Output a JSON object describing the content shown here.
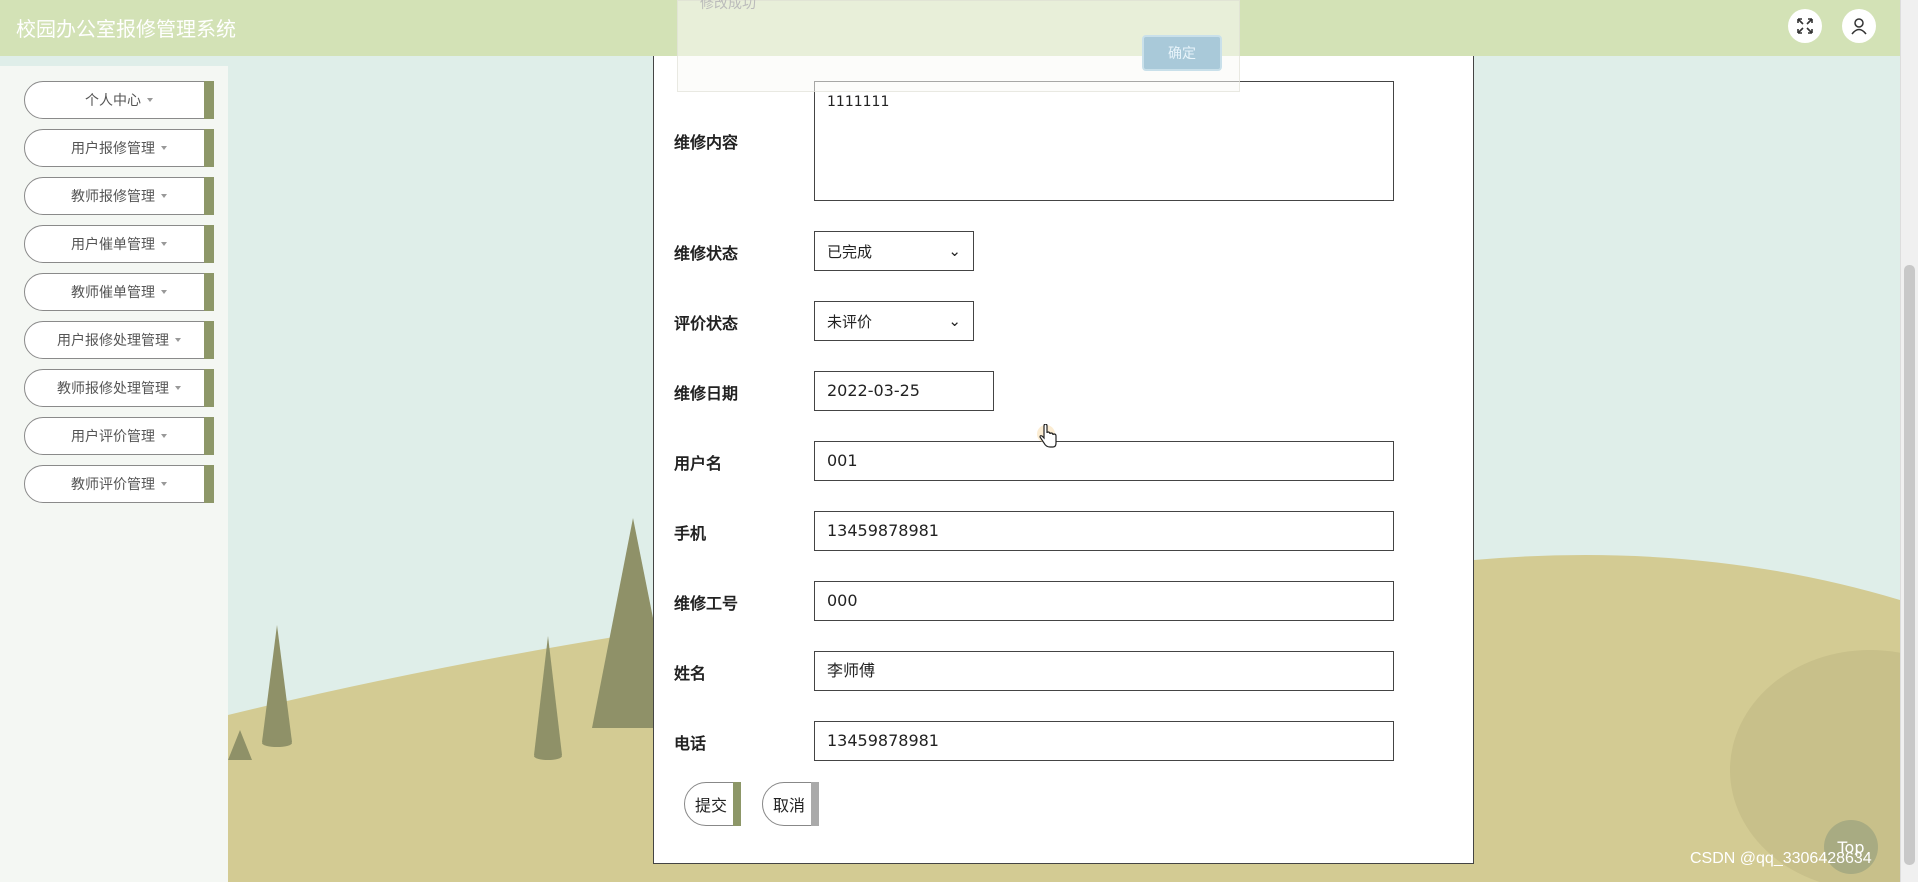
{
  "app": {
    "title": "校园办公室报修管理系统"
  },
  "header": {
    "icons": [
      "fullscreen-icon",
      "user-icon"
    ]
  },
  "sidebar": {
    "items": [
      {
        "label": "个人中心"
      },
      {
        "label": "用户报修管理"
      },
      {
        "label": "教师报修管理"
      },
      {
        "label": "用户催单管理"
      },
      {
        "label": "教师催单管理"
      },
      {
        "label": "用户报修处理管理"
      },
      {
        "label": "教师报修处理管理"
      },
      {
        "label": "用户评价管理"
      },
      {
        "label": "教师评价管理"
      }
    ]
  },
  "toast": {
    "message": "修改成功",
    "ok_label": "确定"
  },
  "form": {
    "content": {
      "label": "维修内容",
      "value": "1111111"
    },
    "status": {
      "label": "维修状态",
      "value": "已完成"
    },
    "review": {
      "label": "评价状态",
      "value": "未评价"
    },
    "date": {
      "label": "维修日期",
      "value": "2022-03-25"
    },
    "username": {
      "label": "用户名",
      "value": "001"
    },
    "phone": {
      "label": "手机",
      "value": "13459878981"
    },
    "worker_id": {
      "label": "维修工号",
      "value": "000"
    },
    "name": {
      "label": "姓名",
      "value": "李师傅"
    },
    "tel": {
      "label": "电话",
      "value": "13459878981"
    },
    "submit_label": "提交",
    "cancel_label": "取消"
  },
  "top_button": {
    "label": "Top"
  },
  "watermark": "CSDN @qq_3306428634",
  "colors": {
    "header": "#d3e2b6",
    "accent": "#8d9768",
    "hill": "#d4cc96",
    "tree": "#8f9168"
  }
}
